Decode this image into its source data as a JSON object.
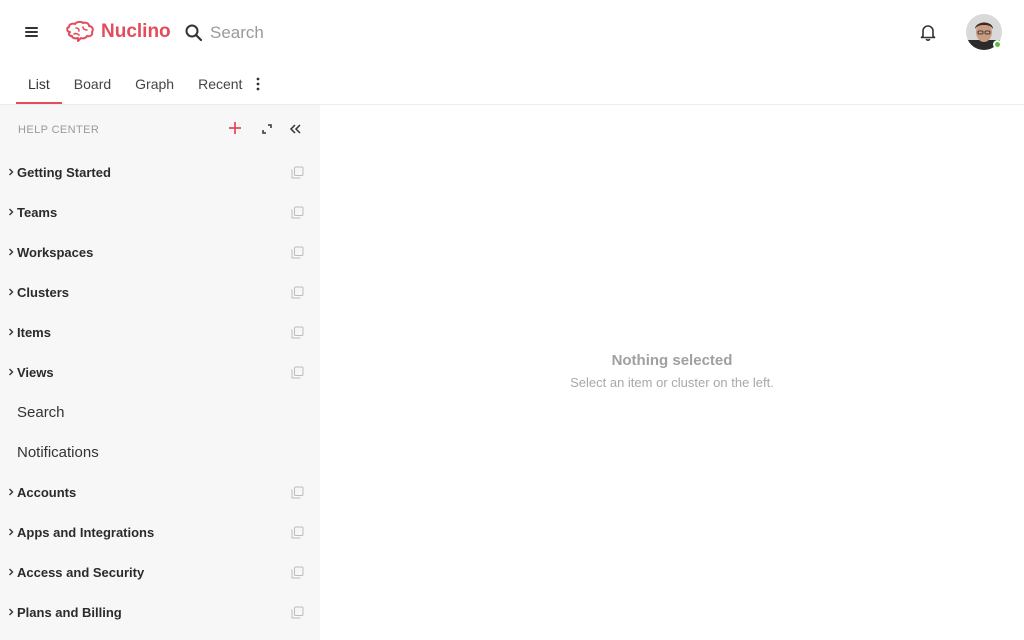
{
  "app": {
    "brand": "Nuclino",
    "accent_color": "#e34d5b"
  },
  "header": {
    "menu_icon": "hamburger-icon",
    "logo_icon": "brain-logo-icon",
    "search": {
      "placeholder": "Search",
      "icon": "search-icon"
    },
    "notifications_icon": "bell-icon",
    "user_status": "online"
  },
  "tabs": [
    {
      "label": "List",
      "active": true
    },
    {
      "label": "Board",
      "active": false
    },
    {
      "label": "Graph",
      "active": false
    },
    {
      "label": "Recent",
      "active": false
    }
  ],
  "sidebar": {
    "title": "HELP CENTER",
    "items": [
      {
        "label": "Getting Started",
        "type": "cluster"
      },
      {
        "label": "Teams",
        "type": "cluster"
      },
      {
        "label": "Workspaces",
        "type": "cluster"
      },
      {
        "label": "Clusters",
        "type": "cluster"
      },
      {
        "label": "Items",
        "type": "cluster"
      },
      {
        "label": "Views",
        "type": "cluster"
      },
      {
        "label": "Search",
        "type": "item"
      },
      {
        "label": "Notifications",
        "type": "item"
      },
      {
        "label": "Accounts",
        "type": "cluster"
      },
      {
        "label": "Apps and Integrations",
        "type": "cluster"
      },
      {
        "label": "Access and Security",
        "type": "cluster"
      },
      {
        "label": "Plans and Billing",
        "type": "cluster"
      }
    ]
  },
  "main": {
    "empty_title": "Nothing selected",
    "empty_subtitle": "Select an item or cluster on the left."
  }
}
